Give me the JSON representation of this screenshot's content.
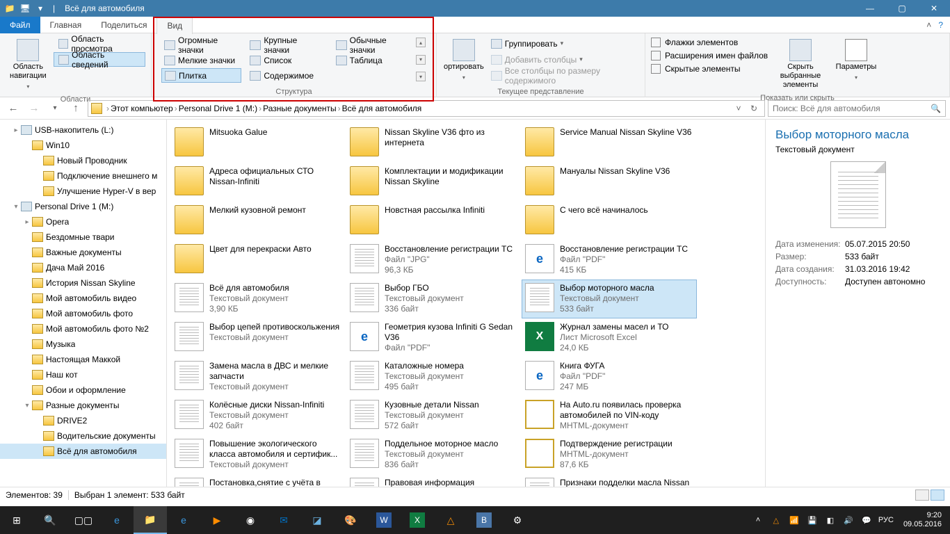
{
  "title": {
    "app": "Всё для автомобиля"
  },
  "tabs": {
    "file": "Файл",
    "home": "Главная",
    "share": "Поделиться",
    "view": "Вид"
  },
  "ribbon": {
    "panes": {
      "nav": "Область навигации",
      "preview": "Область просмотра",
      "details": "Область сведений",
      "group": "Области"
    },
    "layout": {
      "items": [
        "Огромные значки",
        "Крупные значки",
        "Обычные значки",
        "Мелкие значки",
        "Список",
        "Таблица",
        "Плитка",
        "Содержимое"
      ],
      "group": "Структура"
    },
    "currentview": {
      "sort": "ортировать",
      "group": "Группировать",
      "addcols": "Добавить столбцы",
      "fitcols": "Все столбцы по размеру содержимого",
      "label": "Текущее представление"
    },
    "showhide": {
      "chk_checkboxes": "Флажки элементов",
      "chk_extensions": "Расширения имен файлов",
      "chk_hidden": "Скрытые элементы",
      "hide_btn": "Скрыть выбранные элементы",
      "options": "Параметры",
      "label": "Показать или скрыть"
    }
  },
  "breadcrumb": [
    "Этот компьютер",
    "Personal Drive 1 (M:)",
    "Разные документы",
    "Всё для автомобиля"
  ],
  "search_placeholder": "Поиск: Всё для автомобиля",
  "tree": [
    {
      "indent": 1,
      "icon": "drive",
      "exp": "▸",
      "label": "USB-накопитель (L:)"
    },
    {
      "indent": 2,
      "icon": "folder",
      "label": "Win10"
    },
    {
      "indent": 3,
      "icon": "folder",
      "label": "Новый Проводник"
    },
    {
      "indent": 3,
      "icon": "folder",
      "label": "Подключение внешнего м",
      "clip": true
    },
    {
      "indent": 3,
      "icon": "folder",
      "label": "Улучшение Hyper-V в вер",
      "clip": true
    },
    {
      "indent": 1,
      "icon": "drive",
      "exp": "▾",
      "label": "Personal Drive 1 (M:)"
    },
    {
      "indent": 2,
      "icon": "folder",
      "exp": "▸",
      "label": "Opera"
    },
    {
      "indent": 2,
      "icon": "folder",
      "label": "Бездомные твари"
    },
    {
      "indent": 2,
      "icon": "folder",
      "label": "Важные документы"
    },
    {
      "indent": 2,
      "icon": "folder",
      "label": "Дача Май 2016"
    },
    {
      "indent": 2,
      "icon": "folder",
      "label": "История Nissan Skyline"
    },
    {
      "indent": 2,
      "icon": "folder",
      "label": "Мой автомобиль видео"
    },
    {
      "indent": 2,
      "icon": "folder",
      "label": "Мой автомобиль фото"
    },
    {
      "indent": 2,
      "icon": "folder",
      "label": "Мой автомобиль фото №2"
    },
    {
      "indent": 2,
      "icon": "folder",
      "label": "Музыка"
    },
    {
      "indent": 2,
      "icon": "folder",
      "label": "Настоящая Маккой"
    },
    {
      "indent": 2,
      "icon": "folder",
      "label": "Наш кот"
    },
    {
      "indent": 2,
      "icon": "folder",
      "label": "Обои и оформление"
    },
    {
      "indent": 2,
      "icon": "folder",
      "exp": "▾",
      "label": "Разные документы"
    },
    {
      "indent": 3,
      "icon": "folder",
      "label": "DRIVE2"
    },
    {
      "indent": 3,
      "icon": "folder",
      "label": "Водительские документы"
    },
    {
      "indent": 3,
      "icon": "folder",
      "label": "Всё для автомобиля",
      "sel": true
    }
  ],
  "files": [
    {
      "thumb": "folder",
      "name": "Mitsuoka Galue"
    },
    {
      "thumb": "folder",
      "name": "Nissan Skyline V36 фто из интернета"
    },
    {
      "thumb": "folder",
      "name": "Service Manual Nissan Skyline V36"
    },
    {
      "thumb": "folder",
      "name": "Адреса официальных СТО Nissan-Infiniti"
    },
    {
      "thumb": "folder",
      "name": "Комплектации и модификации Nissan Skyline"
    },
    {
      "thumb": "folder",
      "name": "Мануалы Nissan Skyline V36"
    },
    {
      "thumb": "folder",
      "name": "Мелкий кузовной ремонт"
    },
    {
      "thumb": "folder",
      "name": "Новстная рассылка Infiniti"
    },
    {
      "thumb": "folder",
      "name": "С чего всё начиналось"
    },
    {
      "thumb": "folder",
      "name": "Цвет для перекраски Авто"
    },
    {
      "thumb": "text",
      "name": "Восстановление регистрации ТС",
      "meta1": "Файл \"JPG\"",
      "meta2": "96,3 КБ"
    },
    {
      "thumb": "pdf",
      "name": "Восстановление регистрации ТС",
      "meta1": "Файл \"PDF\"",
      "meta2": "415 КБ"
    },
    {
      "thumb": "text",
      "name": "Всё для автомобиля",
      "meta1": "Текстовый документ",
      "meta2": "3,90 КБ"
    },
    {
      "thumb": "text",
      "name": "Выбор ГБО",
      "meta1": "Текстовый документ",
      "meta2": "336 байт"
    },
    {
      "thumb": "text",
      "name": "Выбор моторного масла",
      "meta1": "Текстовый документ",
      "meta2": "533 байт",
      "sel": true
    },
    {
      "thumb": "text",
      "name": "Выбор цепей противоскольжения",
      "meta1": "Текстовый документ"
    },
    {
      "thumb": "pdf",
      "name": "Геометрия кузова Infiniti G Sedan V36",
      "meta1": "Файл \"PDF\""
    },
    {
      "thumb": "xls",
      "name": "Журнал замены масел и ТО",
      "meta1": "Лист Microsoft Excel",
      "meta2": "24,0 КБ"
    },
    {
      "thumb": "text",
      "name": "Замена масла в ДВС и мелкие запчасти",
      "meta1": "Текстовый документ"
    },
    {
      "thumb": "text",
      "name": "Каталожные номера",
      "meta1": "Текстовый документ",
      "meta2": "495 байт"
    },
    {
      "thumb": "pdf",
      "name": "Книга ФУГА",
      "meta1": "Файл \"PDF\"",
      "meta2": "247 МБ"
    },
    {
      "thumb": "text",
      "name": "Колёсные диски Nissan-Infiniti",
      "meta1": "Текстовый документ",
      "meta2": "402 байт"
    },
    {
      "thumb": "text",
      "name": "Кузовные детали Nissan",
      "meta1": "Текстовый документ",
      "meta2": "572 байт"
    },
    {
      "thumb": "mhtml",
      "name": "На Auto.ru появилась проверка автомобилей по VIN-коду",
      "meta1": "MHTML-документ"
    },
    {
      "thumb": "text",
      "name": "Повышение экологического класса автомобиля и сертифик...",
      "meta1": "Текстовый документ"
    },
    {
      "thumb": "text",
      "name": "Поддельное моторное масло",
      "meta1": "Текстовый документ",
      "meta2": "836 байт"
    },
    {
      "thumb": "mhtml",
      "name": "Подтверждение регистрации",
      "meta1": "MHTML-документ",
      "meta2": "87,6 КБ"
    },
    {
      "thumb": "text",
      "name": "Постановка,снятие с учёта в"
    },
    {
      "thumb": "text",
      "name": "Правовая информация"
    },
    {
      "thumb": "text",
      "name": "Признаки подделки масла Nissan"
    }
  ],
  "details": {
    "title": "Выбор моторного масла",
    "type": "Текстовый документ",
    "rows": [
      {
        "k": "Дата изменения:",
        "v": "05.07.2015 20:50"
      },
      {
        "k": "Размер:",
        "v": "533 байт"
      },
      {
        "k": "Дата создания:",
        "v": "31.03.2016 19:42"
      },
      {
        "k": "Доступность:",
        "v": "Доступен автономно"
      }
    ]
  },
  "status": {
    "count": "Элементов: 39",
    "sel": "Выбран 1 элемент: 533 байт"
  },
  "taskbar": {
    "lang": "РУС",
    "time": "9:20",
    "date": "09.05.2016"
  }
}
